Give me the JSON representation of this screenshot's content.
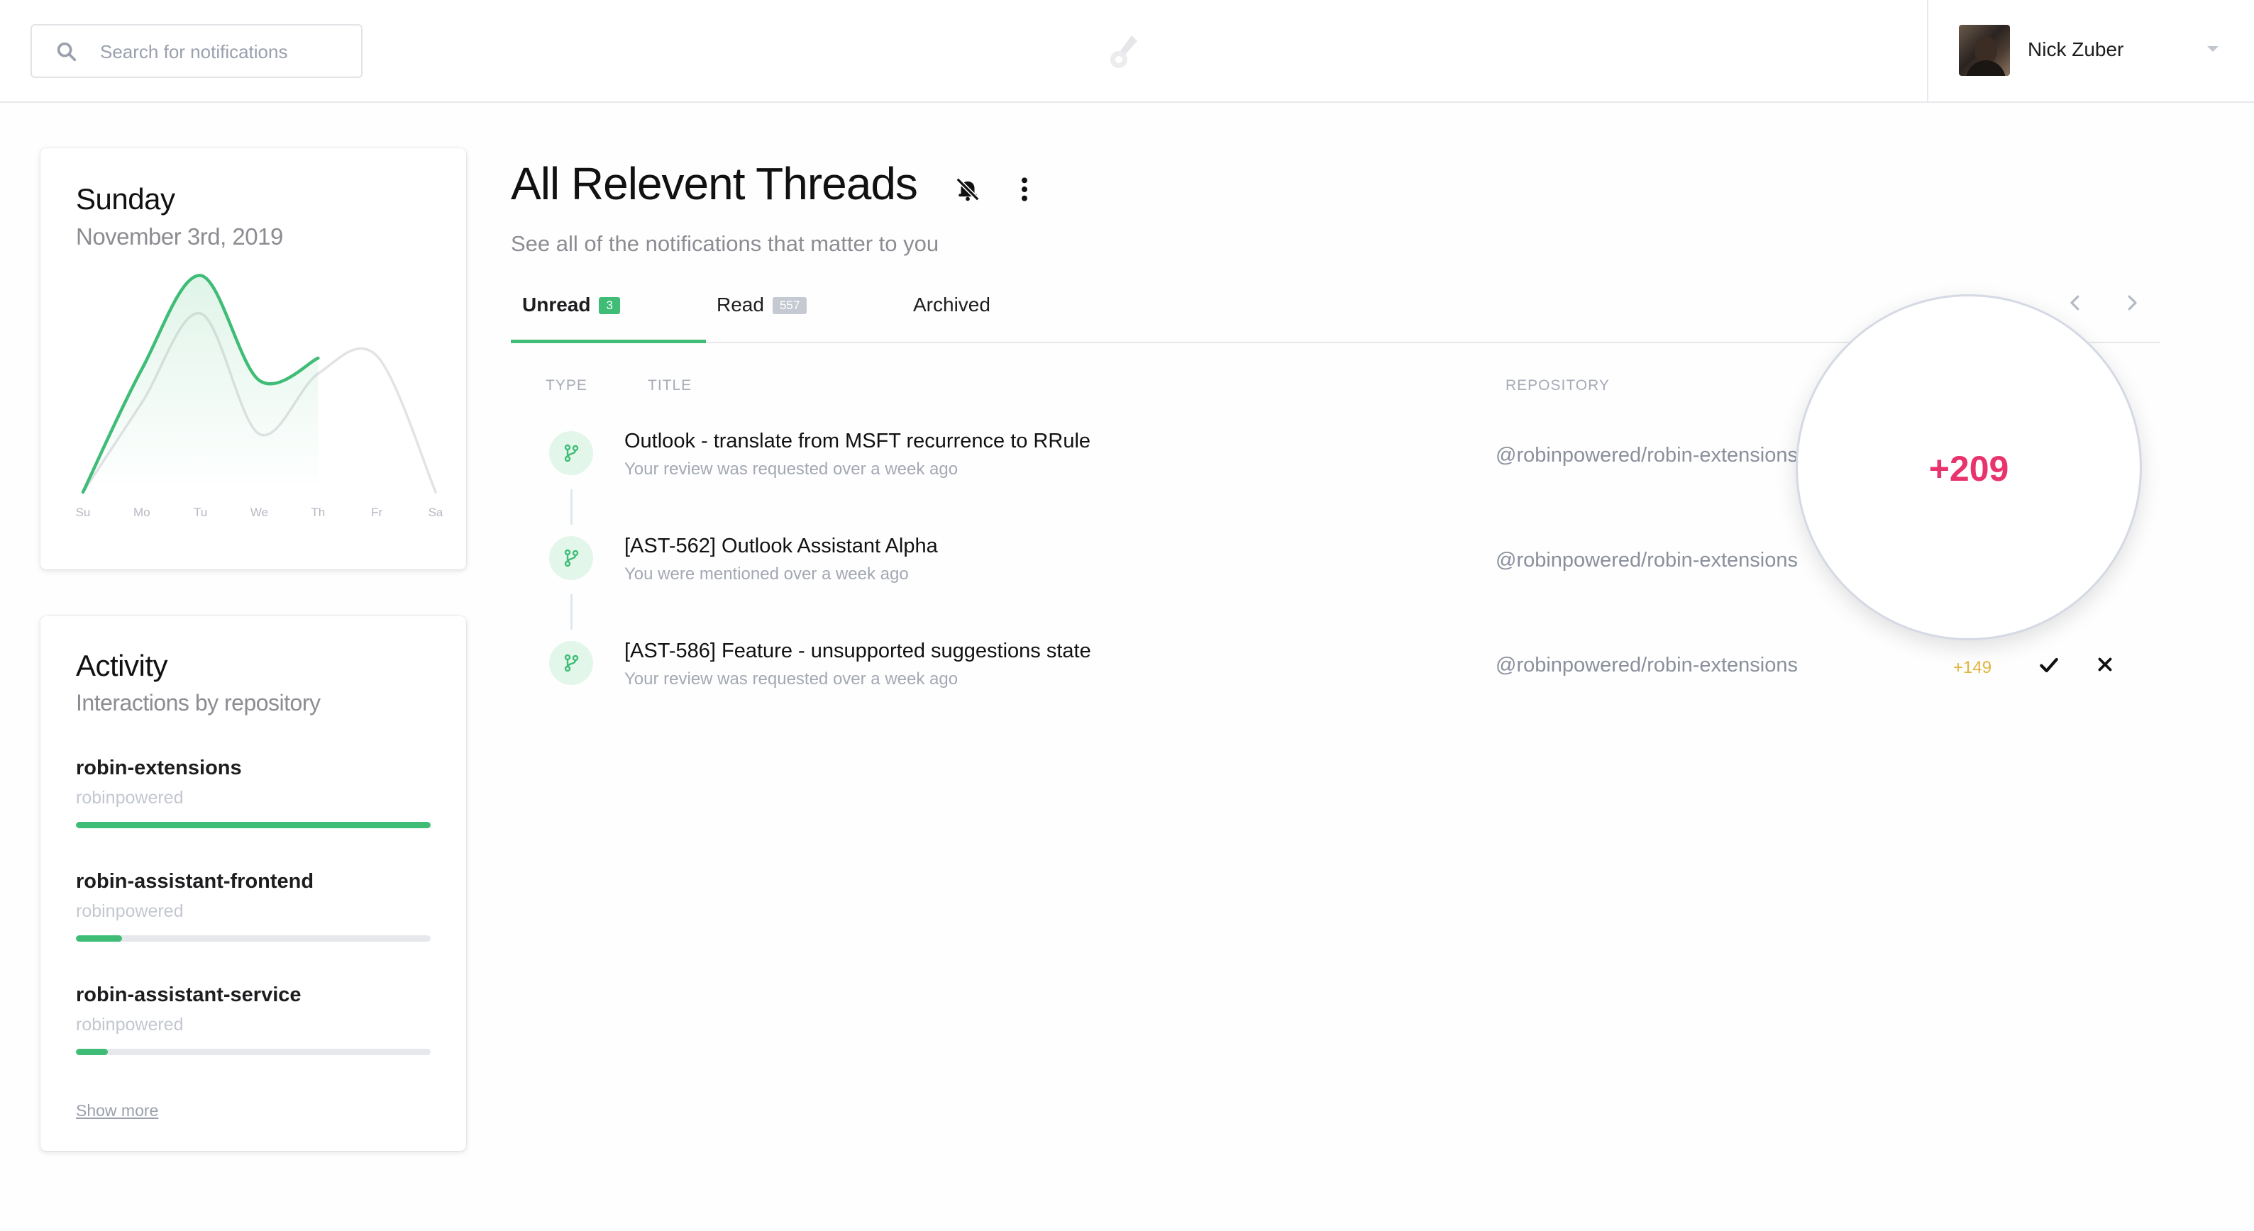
{
  "header": {
    "search_placeholder": "Search for notifications",
    "user_name": "Nick Zuber"
  },
  "day_card": {
    "day": "Sunday",
    "date": "November 3rd, 2019"
  },
  "chart_data": {
    "type": "area",
    "categories": [
      "Su",
      "Mo",
      "Tu",
      "We",
      "Th",
      "Fr",
      "Sa"
    ],
    "series": [
      {
        "values": [
          0,
          55,
          97,
          50,
          60,
          null,
          null
        ],
        "color": "#3fbd76"
      },
      {
        "values": [
          0,
          40,
          80,
          26,
          53,
          61,
          0
        ],
        "color": "#e3e3e6"
      }
    ],
    "ylim": [
      0,
      100
    ],
    "grid": false
  },
  "activity": {
    "title": "Activity",
    "subtitle": "Interactions by repository",
    "repos": [
      {
        "name": "robin-extensions",
        "org": "robinpowered",
        "share": 1.0
      },
      {
        "name": "robin-assistant-frontend",
        "org": "robinpowered",
        "share": 0.13
      },
      {
        "name": "robin-assistant-service",
        "org": "robinpowered",
        "share": 0.09
      }
    ],
    "show_more": "Show more"
  },
  "main": {
    "title": "All Relevent Threads",
    "subtitle": "See all of the notifications that matter to you",
    "tabs": [
      {
        "label": "Unread",
        "count": "3"
      },
      {
        "label": "Read",
        "count": "557"
      },
      {
        "label": "Archived"
      }
    ],
    "columns": {
      "type": "TYPE",
      "title": "TITLE",
      "repository": "REPOSITORY"
    },
    "threads": [
      {
        "title": "Outlook - translate from MSFT recurrence to RRule",
        "desc": "Your review was requested over a week ago",
        "repo": "@robinpowered/robin-extensions",
        "count": ""
      },
      {
        "title": "[AST-562] Outlook Assistant Alpha",
        "desc": "You were mentioned over a week ago",
        "repo": "@robinpowered/robin-extensions",
        "count": ""
      },
      {
        "title": "[AST-586] Feature - unsupported suggestions state",
        "desc": "Your review was requested over a week ago",
        "repo": "@robinpowered/robin-extensions",
        "count": "+149"
      }
    ],
    "magnifier_count": "+209"
  },
  "colors": {
    "accent": "#3fbd76",
    "score_high": "#e8336c",
    "score_mid": "#e0b43a"
  },
  "icons": {
    "search": "search-icon",
    "logo": "comet-logo-icon",
    "caret": "chevron-down-icon",
    "mute": "bell-off-icon",
    "more": "more-vertical-icon",
    "pull_request": "git-branch-icon",
    "check": "check-icon",
    "close": "close-icon"
  }
}
